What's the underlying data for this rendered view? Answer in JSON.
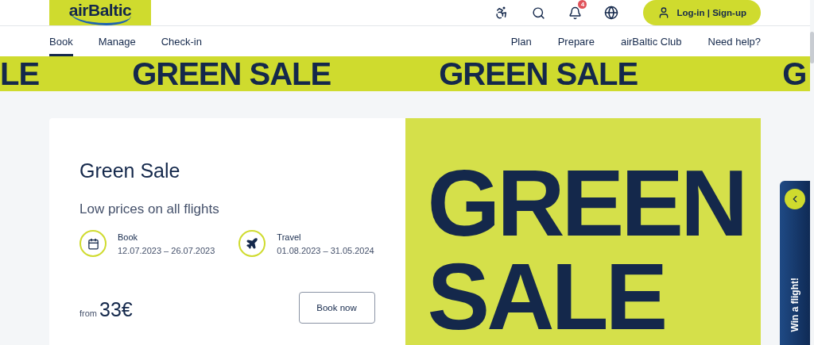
{
  "header": {
    "logo": "airBaltic",
    "notifications": {
      "count": "4"
    },
    "login_button": "Log-in | Sign-up"
  },
  "nav": {
    "left": [
      {
        "label": "Book",
        "selected": true
      },
      {
        "label": "Manage",
        "selected": false
      },
      {
        "label": "Check-in",
        "selected": false
      }
    ],
    "right": [
      {
        "label": "Plan"
      },
      {
        "label": "Prepare"
      },
      {
        "label": "airBaltic Club"
      },
      {
        "label": "Need help?"
      }
    ]
  },
  "marquee": [
    "LE",
    "GREEN SALE",
    "GREEN SALE",
    "G"
  ],
  "promo": {
    "title": "Green Sale",
    "subtitle": "Low prices on all flights",
    "periods": [
      {
        "kind": "calendar",
        "label": "Book",
        "dates": "12.07.2023 – 26.07.2023"
      },
      {
        "kind": "plane",
        "label": "Travel",
        "dates": "01.08.2023 – 31.05.2024"
      }
    ],
    "price_prefix": "from",
    "price": "33€",
    "button": "Book now",
    "hero": [
      "GREEN",
      "SALE"
    ]
  },
  "side_tab": {
    "label": "Win a flight!"
  }
}
